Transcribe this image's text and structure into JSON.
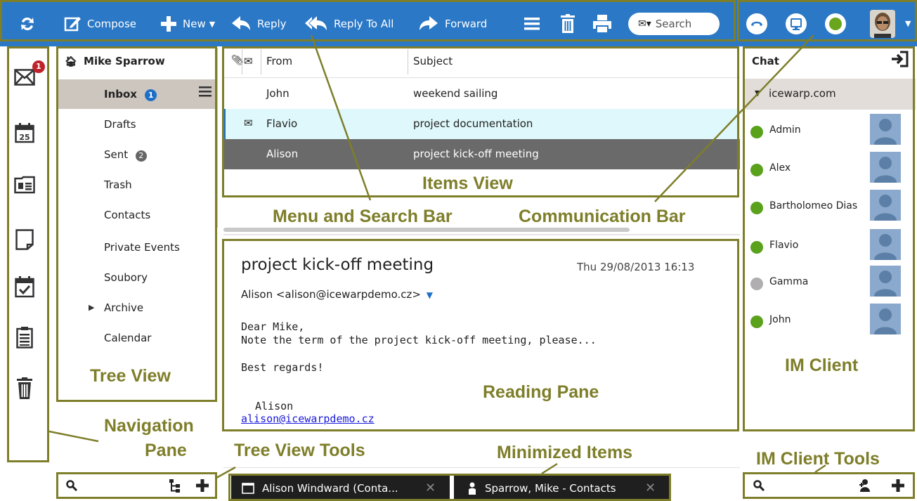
{
  "toolbar": {
    "compose": "Compose",
    "new": "New",
    "reply": "Reply",
    "reply_all": "Reply To All",
    "forward": "Forward",
    "search_placeholder": "Search",
    "accent_color": "#2a78c6",
    "icons": [
      "refresh-icon",
      "compose-icon",
      "plus-icon",
      "reply-icon",
      "reply-all-icon",
      "forward-icon",
      "menu-icon",
      "delete-icon",
      "print-icon"
    ]
  },
  "comm_bar": {
    "status_color": "#6aa51e",
    "icons": [
      "phone-icon",
      "screen-share-icon",
      "status-icon",
      "avatar"
    ]
  },
  "tree": {
    "account": "Mike Sparrow",
    "items": [
      {
        "label": "Inbox",
        "badge": "1"
      },
      {
        "label": "Drafts"
      },
      {
        "label": "Sent",
        "badge": "2"
      },
      {
        "label": "Trash"
      },
      {
        "label": "Contacts"
      },
      {
        "label": "Private Events"
      },
      {
        "label": "Soubory"
      },
      {
        "label": "Archive"
      },
      {
        "label": "Calendar"
      }
    ]
  },
  "nav": {
    "mail_badge": "1",
    "icons": [
      "mail-icon",
      "calendar-icon",
      "contacts-icon",
      "notes-icon",
      "tasks-icon",
      "journal-icon",
      "trash-icon"
    ]
  },
  "items": {
    "columns": [
      "From",
      "Subject"
    ],
    "rows": [
      {
        "from": "John",
        "subject": "weekend sailing"
      },
      {
        "from": "Flavio",
        "subject": "project documentation"
      },
      {
        "from": "Alison",
        "subject": "project kick-off meeting"
      }
    ]
  },
  "reading": {
    "subject": "project kick-off meeting",
    "date": "Thu 29/08/2013 16:13",
    "sender": "Alison <alison@icewarpdemo.cz>",
    "body_line1": "Dear Mike,",
    "body_line2": "Note the term of the project kick-off meeting, please...",
    "body_line3": "Best regards!",
    "signature_name": "Alison",
    "signature_email": "alison@icewarpdemo.cz"
  },
  "chat": {
    "title": "Chat",
    "group": "icewarp.com",
    "contacts": [
      {
        "name": "Admin",
        "status": "online"
      },
      {
        "name": "Alex",
        "status": "online"
      },
      {
        "name": "Bartholomeo Dias",
        "status": "online"
      },
      {
        "name": "Flavio",
        "status": "online"
      },
      {
        "name": "Gamma",
        "status": "offline"
      },
      {
        "name": "John",
        "status": "online"
      }
    ],
    "online_color": "#5aa11c",
    "offline_color": "#b0aeb0"
  },
  "minimized": [
    {
      "label": "Alison Windward (Conta..."
    },
    {
      "label": "Sparrow, Mike - Contacts"
    }
  ],
  "annotations": {
    "items_view": "Items View",
    "menu_search": "Menu and Search Bar",
    "comm_bar": "Communication Bar",
    "tree_view": "Tree View",
    "reading_pane": "Reading Pane",
    "im_client": "IM Client",
    "navigation_pane_1": "Navigation",
    "navigation_pane_2": "Pane",
    "tree_view_tools": "Tree View Tools",
    "minimized_items": "Minimized Items",
    "im_client_tools": "IM Client Tools",
    "color": "#7e7e2a"
  }
}
